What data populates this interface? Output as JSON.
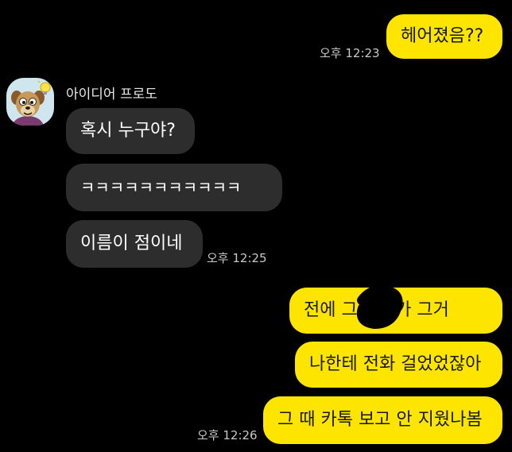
{
  "chat": {
    "sender_name": "아이디어 프로도",
    "messages": [
      {
        "id": "m1",
        "direction": "outgoing",
        "text": "헤어졌음??",
        "time": "오후 12:23"
      },
      {
        "id": "m2",
        "direction": "incoming",
        "text": "혹시 누구야?"
      },
      {
        "id": "m3",
        "direction": "incoming",
        "text": "ㅋㅋㅋㅋㅋㅋㅋㅋㅋㅋㅋ"
      },
      {
        "id": "m4",
        "direction": "incoming",
        "text": "이름이 점이네",
        "time": "오후 12:25"
      },
      {
        "id": "m5",
        "direction": "outgoing",
        "text": "전에 그      앱인가 그거"
      },
      {
        "id": "m6",
        "direction": "outgoing",
        "text": "나한테 전화 걸었었잖아"
      },
      {
        "id": "m7",
        "direction": "outgoing",
        "text": "그 때 카톡 보고 안 지웠나봄",
        "time": "오후 12:26"
      }
    ]
  },
  "colors": {
    "background": "#000000",
    "outgoing_bubble": "#FEE500",
    "incoming_bubble": "#2D2D2D",
    "timestamp": "#C8C8C8"
  }
}
